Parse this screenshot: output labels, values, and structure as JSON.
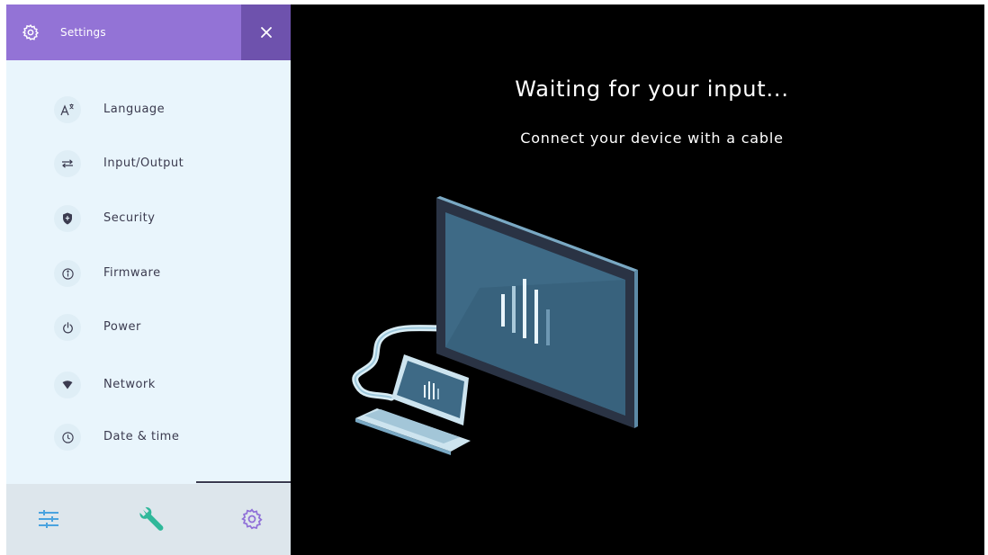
{
  "settings_panel": {
    "title": "Settings",
    "header_icon": "gear-icon",
    "close_icon": "close-icon",
    "items": [
      {
        "label": "Language",
        "icon": "language-icon"
      },
      {
        "label": "Input/Output",
        "icon": "input-output-icon"
      },
      {
        "label": "Security",
        "icon": "shield-icon"
      },
      {
        "label": "Firmware",
        "icon": "info-icon"
      },
      {
        "label": "Power",
        "icon": "power-icon"
      },
      {
        "label": "Network",
        "icon": "network-icon"
      },
      {
        "label": "Date & time",
        "icon": "clock-icon"
      }
    ],
    "footer": [
      {
        "icon": "sliders-icon",
        "color": "#4aa3df"
      },
      {
        "icon": "wrench-icon",
        "color": "#2fb89a"
      },
      {
        "icon": "gear-icon",
        "color": "#8f6fd8"
      }
    ]
  },
  "main": {
    "title": "Waiting for your input...",
    "subtitle": "Connect your device with a cable"
  },
  "colors": {
    "header_bg": "#9373d6",
    "close_bg": "#6e52ad",
    "panel_bg": "#e9f5fc",
    "main_bg": "#000000"
  }
}
